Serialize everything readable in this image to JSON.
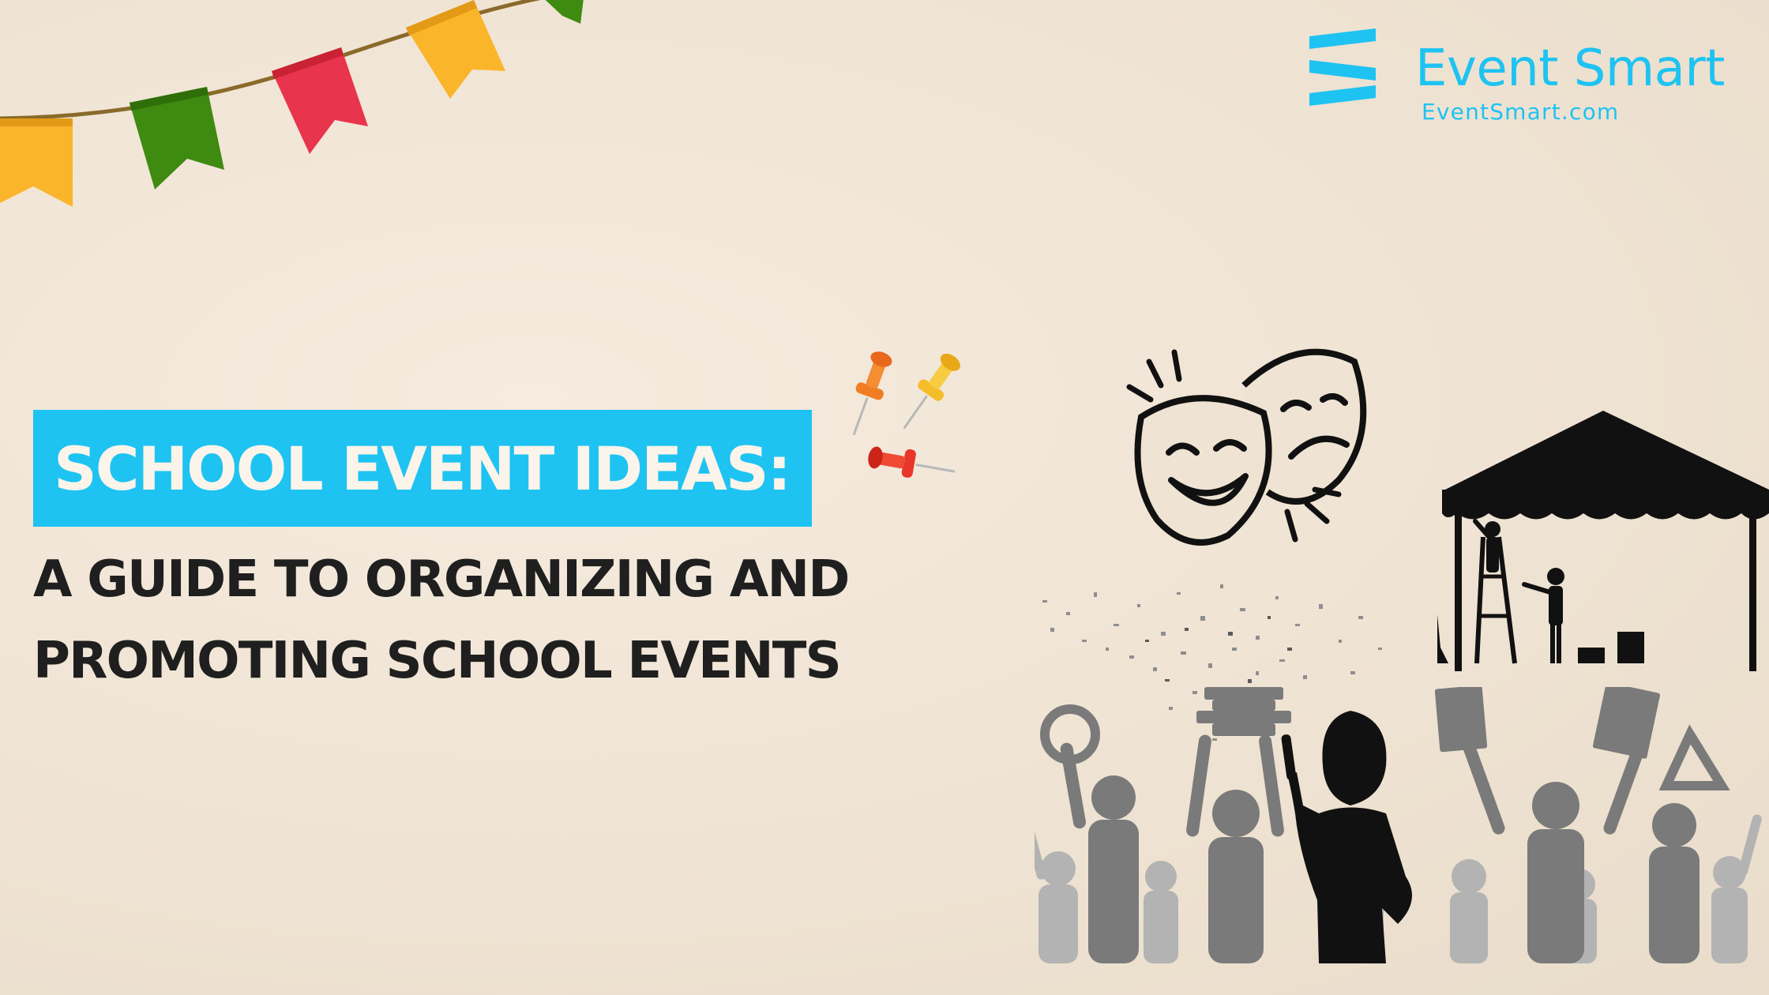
{
  "logo": {
    "name": "Event Smart",
    "url": "EventSmart.com",
    "color": "#1ec3f2"
  },
  "headline": {
    "title": "SCHOOL EVENT IDEAS:",
    "subtitle_line1": "A GUIDE TO ORGANIZING AND",
    "subtitle_line2": "PROMOTING SCHOOL EVENTS"
  },
  "colors": {
    "background": "#efe3d3",
    "accent": "#1ec3f2",
    "text_dark": "#1f1f1f",
    "flag_yellow": "#fbb52a",
    "flag_green": "#3f8a10",
    "flag_red": "#e8344c"
  },
  "illustrations": {
    "bunting": "bunting-flags-icon",
    "pins": "push-pins-icon",
    "masks": "theater-masks-icon",
    "tent": "canopy-tent-icon",
    "crowd": "students-crowd-silhouette",
    "confetti": "confetti-burst"
  }
}
